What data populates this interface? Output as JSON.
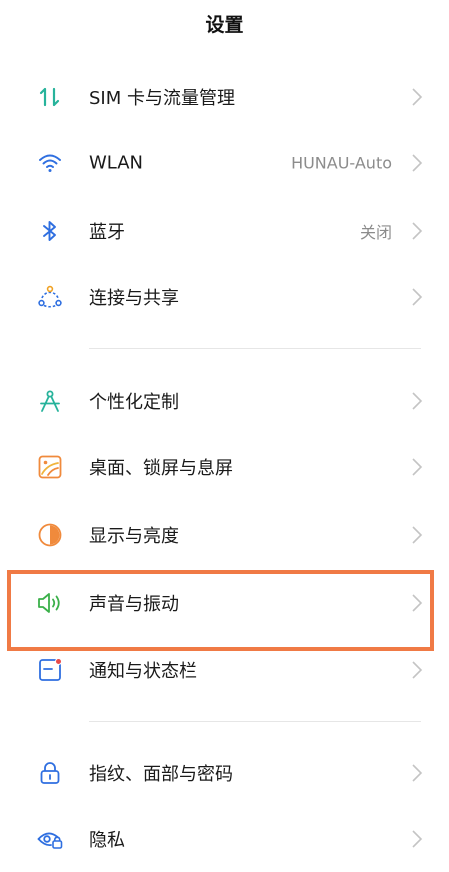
{
  "header": {
    "title": "设置"
  },
  "colors": {
    "highlight": "#f07a45",
    "chevron": "#c4c4c4",
    "value_text": "#8c8c8c"
  },
  "items": [
    {
      "id": "sim",
      "label": "SIM 卡与流量管理",
      "value": "",
      "icon": "sim-data-icon"
    },
    {
      "id": "wlan",
      "label": "WLAN",
      "value": "HUNAU-Auto",
      "icon": "wifi-icon"
    },
    {
      "id": "bluetooth",
      "label": "蓝牙",
      "value": "关闭",
      "icon": "bluetooth-icon"
    },
    {
      "id": "sharing",
      "label": "连接与共享",
      "value": "",
      "icon": "connection-share-icon"
    },
    {
      "id": "personalize",
      "label": "个性化定制",
      "value": "",
      "icon": "compass-icon"
    },
    {
      "id": "wallpaper",
      "label": "桌面、锁屏与息屏",
      "value": "",
      "icon": "wallpaper-icon"
    },
    {
      "id": "display",
      "label": "显示与亮度",
      "value": "",
      "icon": "brightness-icon"
    },
    {
      "id": "sound",
      "label": "声音与振动",
      "value": "",
      "icon": "speaker-icon"
    },
    {
      "id": "notifications",
      "label": "通知与状态栏",
      "value": "",
      "icon": "notification-icon"
    },
    {
      "id": "fingerprint",
      "label": "指纹、面部与密码",
      "value": "",
      "icon": "lock-icon"
    },
    {
      "id": "privacy",
      "label": "隐私",
      "value": "",
      "icon": "privacy-eye-icon"
    }
  ]
}
